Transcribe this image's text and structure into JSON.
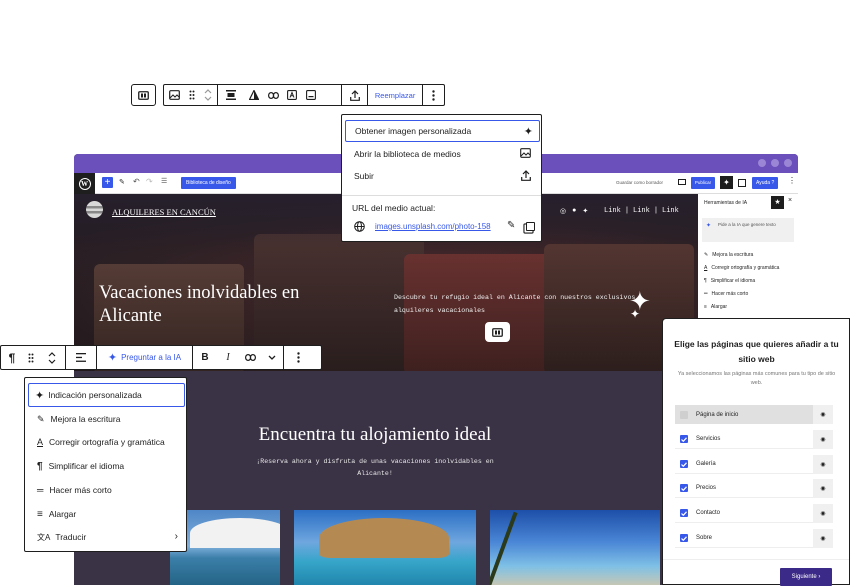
{
  "image_toolbar": {
    "replace_label": "Reemplazar"
  },
  "media_menu": {
    "items": [
      {
        "label": "Obtener imagen personalizada",
        "icon": "sparkle-icon"
      },
      {
        "label": "Abrir la biblioteca de medios",
        "icon": "image-icon"
      },
      {
        "label": "Subir",
        "icon": "upload-icon"
      }
    ],
    "current_url_label": "URL del medio actual:",
    "current_url": "images.unsplash.com/photo-158"
  },
  "editor": {
    "design_library": "Biblioteca de diseño",
    "save_draft": "Guardar como borrador",
    "publish": "Publicar",
    "help": "Ayuda",
    "site_title": "ALQUILERES EN CANCÚN",
    "header_links": [
      "Link",
      "Link",
      "Link"
    ],
    "hero_title": "Vacaciones inolvidables en Alicante",
    "hero_text": "Descubre tu refugio ideal en Alicante con nuestros exclusivos alquileres vacacionales",
    "section_title": "Encuentra tu alojamiento ideal",
    "section_text": "¡Reserva ahora y disfruta de unas vacaciones inolvidables en Alicante!"
  },
  "ai_sidebar": {
    "title": "Herramientas de IA",
    "prompt_placeholder": "Pide a la IA que genere texto",
    "items": [
      "Mejora la escritura",
      "Corregir ortografía y gramática",
      "Simplificar el idioma",
      "Hacer más corto",
      "Alargar"
    ]
  },
  "text_toolbar": {
    "ask_ai_label": "Preguntar a la IA"
  },
  "ai_menu": {
    "items": [
      {
        "label": "Indicación personalizada",
        "icon": "sparkle-icon"
      },
      {
        "label": "Mejora la escritura",
        "icon": "pen-icon"
      },
      {
        "label": "Corregir ortografía y gramática",
        "icon": "spellcheck-icon"
      },
      {
        "label": "Simplificar el idioma",
        "icon": "paragraph-icon"
      },
      {
        "label": "Hacer más corto",
        "icon": "shorter-icon"
      },
      {
        "label": "Alargar",
        "icon": "longer-icon"
      },
      {
        "label": "Traducir",
        "icon": "translate-icon"
      }
    ]
  },
  "pages_panel": {
    "title": "Elige las páginas que quieres añadir a tu sitio web",
    "subtitle": "Ya seleccionamos las páginas más comunes para tu tipo de sitio web.",
    "pages": [
      "Página de inicio",
      "Servicios",
      "Galería",
      "Precios",
      "Contacto",
      "Sobre"
    ],
    "next_label": "Siguiente"
  }
}
